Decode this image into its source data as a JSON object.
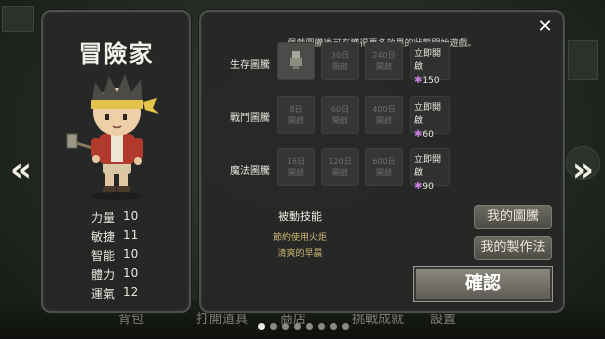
{
  "character": {
    "title": "冒險家",
    "stats": [
      {
        "label": "力量",
        "value": "10"
      },
      {
        "label": "敏捷",
        "value": "11"
      },
      {
        "label": "智能",
        "value": "10"
      },
      {
        "label": "體力",
        "value": "10"
      },
      {
        "label": "運氣",
        "value": "12"
      }
    ]
  },
  "totems": {
    "hint": "佩戴圖騰後可在獲得更多效果的狀態開始遊戲。",
    "rows": [
      {
        "label": "生存圖騰",
        "slots": [
          {
            "day": "",
            "text": ""
          },
          {
            "day": "30日",
            "text": "開啟"
          },
          {
            "day": "240日",
            "text": "開啟"
          }
        ],
        "unlock_label": "立即開啟",
        "cost": "150"
      },
      {
        "label": "戰鬥圖騰",
        "slots": [
          {
            "day": "8日",
            "text": "開啟"
          },
          {
            "day": "60日",
            "text": "開啟"
          },
          {
            "day": "400日",
            "text": "開啟"
          }
        ],
        "unlock_label": "立即開啟",
        "cost": "60"
      },
      {
        "label": "魔法圖騰",
        "slots": [
          {
            "day": "16日",
            "text": "開啟"
          },
          {
            "day": "120日",
            "text": "開啟"
          },
          {
            "day": "600日",
            "text": "開啟"
          }
        ],
        "unlock_label": "立即開啟",
        "cost": "90"
      }
    ]
  },
  "passive": {
    "title": "被動技能",
    "skills": [
      "節約使用火炬",
      "清爽的早晨"
    ]
  },
  "buttons": {
    "my_totems": "我的圖騰",
    "my_recipes": "我的製作法",
    "confirm": "確認"
  },
  "icons": {
    "close": "close-icon",
    "prev": "chevron-left-icon",
    "next": "chevron-right-icon",
    "gem": "purple-gem-icon"
  },
  "bottom_nav": [
    "背包",
    "打開道具",
    "商店",
    "挑戰成就",
    "設置"
  ],
  "colors": {
    "skill_text": "#cdb770",
    "gem": "#c77be0",
    "panel_bg": "#262828"
  },
  "pagination": {
    "total": 8,
    "active": 1
  }
}
